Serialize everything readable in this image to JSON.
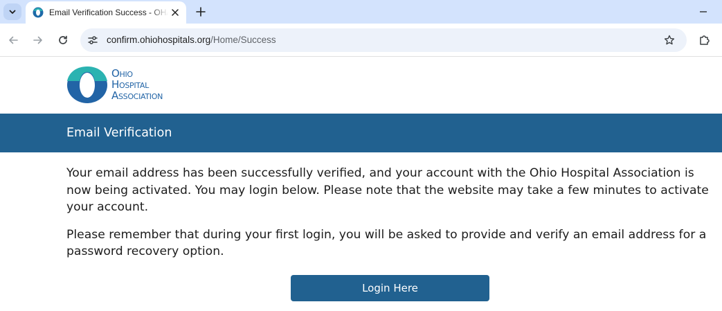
{
  "browser": {
    "tab": {
      "title": "Email Verification Success - OHA",
      "favicon": "oha-logo-icon"
    },
    "address_bar": {
      "domain": "confirm.ohiohospitals.org",
      "path": "/Home/Success"
    },
    "icons": {
      "tab_search": "chevron-down-icon",
      "close": "close-icon",
      "new_tab": "plus-icon",
      "minimize": "minimize-icon",
      "back": "back-arrow-icon",
      "forward": "forward-arrow-icon",
      "reload": "reload-icon",
      "site_info": "tune-icon",
      "bookmark": "star-icon",
      "extensions": "puzzle-icon"
    }
  },
  "logo": {
    "line1": "Ohio",
    "line2": "Hospital",
    "line3": "Association",
    "colors": {
      "teal": "#2bb3b1",
      "blue": "#2264a6"
    }
  },
  "banner": {
    "title": "Email Verification",
    "color": "#216190"
  },
  "content": {
    "paragraph1": "Your email address has been successfully verified, and your account with the Ohio Hospital Association is now being activated. You may login below. Please note that the website may take a few minutes to activate your account.",
    "paragraph2": "Please remember that during your first login, you will be asked to provide and verify an email address for a password recovery option."
  },
  "login_button": {
    "label": "Login Here",
    "color": "#216190"
  }
}
